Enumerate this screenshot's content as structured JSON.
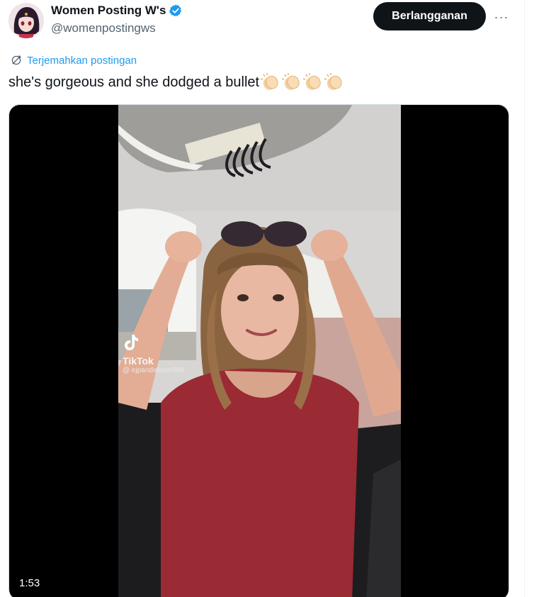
{
  "author": {
    "display_name": "Women Posting W's",
    "handle": "@womenpostingws",
    "verified": true,
    "verified_color": "#1d9bf0"
  },
  "actions": {
    "subscribe_label": "Berlangganan",
    "more_label": "···"
  },
  "translate": {
    "label": "Terjemahkan postingan"
  },
  "tweet": {
    "text": "she's gorgeous and she dodged a bullet",
    "emojis": [
      "clapping-hands",
      "clapping-hands",
      "clapping-hands",
      "clapping-hands"
    ]
  },
  "media": {
    "type": "video",
    "duration": "1:53",
    "watermark_brand": "TikTok",
    "watermark_user": "@ ejpandalover999"
  },
  "colors": {
    "accent": "#1d9bf0",
    "button_bg": "#0f1419",
    "text_secondary": "#536471"
  }
}
